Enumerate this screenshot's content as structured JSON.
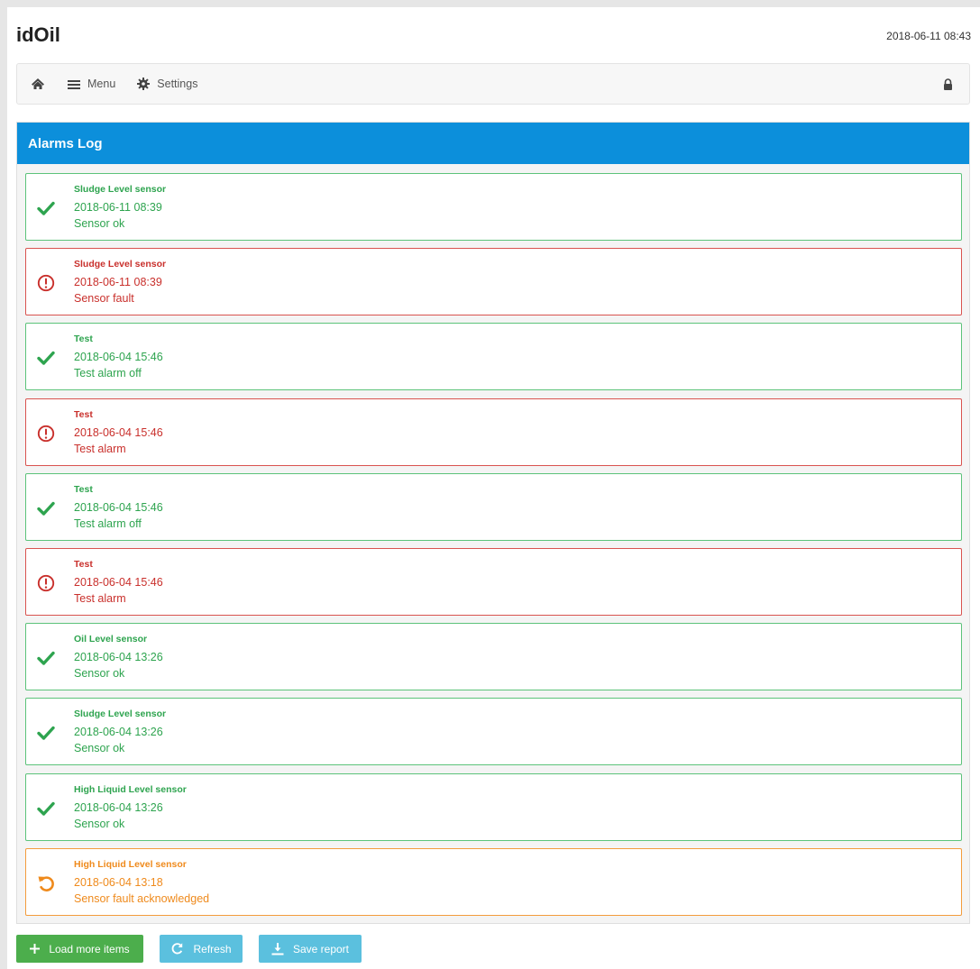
{
  "app": {
    "title": "idOil",
    "clock": "2018-06-11 08:43"
  },
  "nav": {
    "home_icon": "home-icon",
    "menu_label": "Menu",
    "settings_label": "Settings",
    "lock_icon": "lock-icon"
  },
  "colors": {
    "header_blue": "#0c8fdb",
    "ok_green": "#2ea44f",
    "fault_red": "#c9302c",
    "ack_orange": "#ef8a1c",
    "button_green": "#4cae4c",
    "button_blue": "#5bc0de"
  },
  "panel": {
    "title": "Alarms Log"
  },
  "alarms": [
    {
      "status": "ok",
      "icon": "check-icon",
      "title": "Sludge Level sensor",
      "time": "2018-06-11 08:39",
      "message": "Sensor ok"
    },
    {
      "status": "fault",
      "icon": "alert-circle-icon",
      "title": "Sludge Level sensor",
      "time": "2018-06-11 08:39",
      "message": "Sensor fault"
    },
    {
      "status": "ok",
      "icon": "check-icon",
      "title": "Test",
      "time": "2018-06-04 15:46",
      "message": "Test alarm off"
    },
    {
      "status": "fault",
      "icon": "alert-circle-icon",
      "title": "Test",
      "time": "2018-06-04 15:46",
      "message": "Test alarm"
    },
    {
      "status": "ok",
      "icon": "check-icon",
      "title": "Test",
      "time": "2018-06-04 15:46",
      "message": "Test alarm off"
    },
    {
      "status": "fault",
      "icon": "alert-circle-icon",
      "title": "Test",
      "time": "2018-06-04 15:46",
      "message": "Test alarm"
    },
    {
      "status": "ok",
      "icon": "check-icon",
      "title": "Oil Level sensor",
      "time": "2018-06-04 13:26",
      "message": "Sensor ok"
    },
    {
      "status": "ok",
      "icon": "check-icon",
      "title": "Sludge Level sensor",
      "time": "2018-06-04 13:26",
      "message": "Sensor ok"
    },
    {
      "status": "ok",
      "icon": "check-icon",
      "title": "High Liquid Level sensor",
      "time": "2018-06-04 13:26",
      "message": "Sensor ok"
    },
    {
      "status": "ack",
      "icon": "undo-icon",
      "title": "High Liquid Level sensor",
      "time": "2018-06-04 13:18",
      "message": "Sensor fault acknowledged"
    }
  ],
  "buttons": {
    "load_more_label": "Load more items",
    "refresh_label": "Refresh",
    "save_report_label": "Save report"
  }
}
